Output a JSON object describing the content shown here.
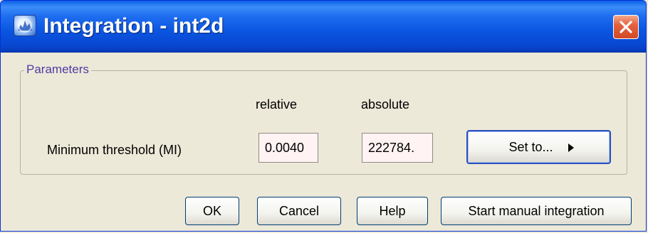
{
  "window": {
    "title": "Integration - int2d",
    "app_icon": "spectrum-app-icon",
    "close_icon": "close-icon"
  },
  "parameters": {
    "legend": "Parameters",
    "columns": {
      "relative": "relative",
      "absolute": "absolute"
    },
    "rows": [
      {
        "label": "Minimum threshold (MI)",
        "relative_value": "0.0040",
        "absolute_value": "222784."
      }
    ],
    "set_to_label": "Set to...",
    "set_to_icon": "triangle-right-icon"
  },
  "footer": {
    "ok": "OK",
    "cancel": "Cancel",
    "help": "Help",
    "start_manual": "Start manual integration"
  },
  "colors": {
    "titlebar": "#0a55e0",
    "legend_text": "#4f3ba3",
    "field_bg": "#fff3f3",
    "close_button": "#d24a26",
    "window_bg": "#ece9d8"
  }
}
